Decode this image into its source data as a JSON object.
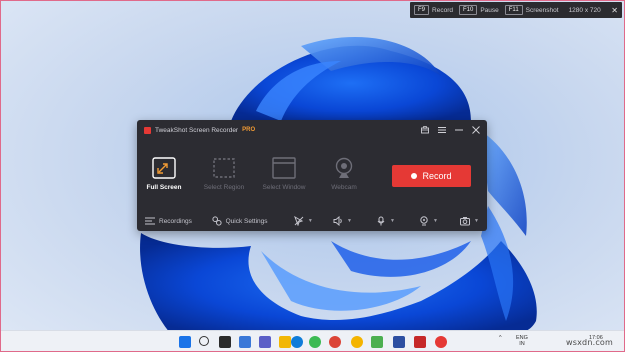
{
  "hotkeys": {
    "record_key": "F9",
    "record_label": "Record",
    "pause_key": "F10",
    "pause_label": "Pause",
    "screenshot_key": "F11",
    "screenshot_label": "Screenshot",
    "resolution": "1280 x 720",
    "close_icon": "close-icon"
  },
  "recorder": {
    "title": "TweakShot Screen Recorder",
    "badge": "PRO",
    "modes": [
      {
        "label": "Full Screen",
        "icon": "fullscreen-icon",
        "active": true
      },
      {
        "label": "Select Region",
        "icon": "region-icon",
        "active": false
      },
      {
        "label": "Select Window",
        "icon": "window-icon",
        "active": false
      },
      {
        "label": "Webcam",
        "icon": "webcam-icon",
        "active": false
      }
    ],
    "record_label": "Record",
    "toolbar": {
      "recordings_label": "Recordings",
      "quick_settings_label": "Quick Settings"
    },
    "colors": {
      "accent": "#e53935",
      "badge": "#f39c34",
      "panel": "#2c2c32"
    }
  },
  "taskbar": {
    "lang_line1": "ENG",
    "lang_line2": "IN",
    "time": "17:06"
  },
  "watermark": "wsxdn.com"
}
